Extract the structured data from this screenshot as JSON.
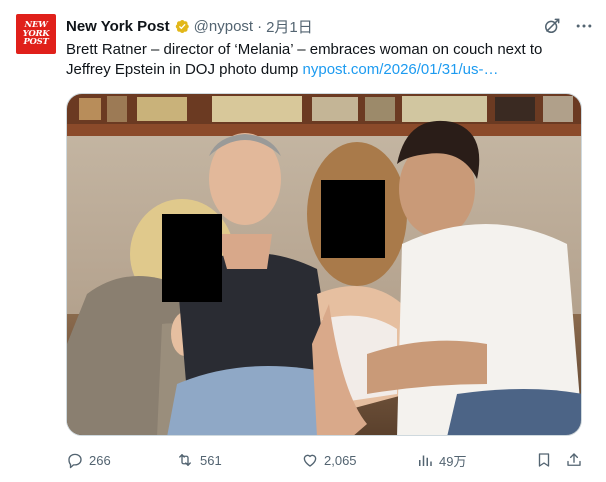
{
  "tweet": {
    "avatar_lines": [
      "NEW",
      "YORK",
      "POST"
    ],
    "display_name": "New York Post",
    "verified_color": "#e2b719",
    "handle": "@nypost",
    "separator": "·",
    "date": "2月1日",
    "header_icons": [
      "grok-icon",
      "more-icon"
    ],
    "text": "Brett Ratner – director of ‘Melania’ – embraces woman on couch next to Jeffrey Epstein in DOJ photo dump ",
    "link_text": "nypost.com/2026/01/31/us-…",
    "media_description_icon": "photo"
  },
  "actions": {
    "replies": "266",
    "reposts": "561",
    "likes": "2,065",
    "views": "49万"
  },
  "colors": {
    "brand_red": "#e0201a",
    "link_blue": "#1d9bf0",
    "muted": "#536471",
    "text": "#0f1419",
    "redaction_box": "#000000"
  }
}
